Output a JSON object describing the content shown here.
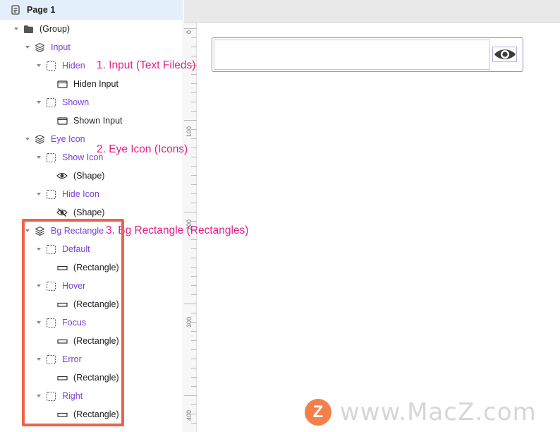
{
  "layers_panel": {
    "page": {
      "label": "Page 1",
      "icon": "page-icon"
    },
    "rows": [
      {
        "label": "(Group)",
        "icon": "folder-icon",
        "style": "dark",
        "chevron": true
      },
      {
        "label": "Input",
        "icon": "layers-icon",
        "style": "purple",
        "chevron": true
      },
      {
        "label": "Hiden",
        "icon": "dashed-frame-icon",
        "style": "purple",
        "chevron": true
      },
      {
        "label": "Hiden Input",
        "icon": "input-box-icon",
        "style": "dark",
        "chevron": false
      },
      {
        "label": "Shown",
        "icon": "dashed-frame-icon",
        "style": "purple",
        "chevron": true
      },
      {
        "label": "Shown Input",
        "icon": "input-box-icon",
        "style": "dark",
        "chevron": false
      },
      {
        "label": "Eye Icon",
        "icon": "layers-icon",
        "style": "purple",
        "chevron": true
      },
      {
        "label": "Show Icon",
        "icon": "dashed-frame-icon",
        "style": "purple",
        "chevron": true
      },
      {
        "label": "(Shape)",
        "icon": "eye-icon",
        "style": "dark",
        "chevron": false
      },
      {
        "label": "Hide Icon",
        "icon": "dashed-frame-icon",
        "style": "purple",
        "chevron": true
      },
      {
        "label": "(Shape)",
        "icon": "eye-off-icon",
        "style": "dark",
        "chevron": false
      },
      {
        "label": "Bg Rectangle",
        "icon": "layers-icon",
        "style": "purple",
        "chevron": true
      },
      {
        "label": "Default",
        "icon": "dashed-frame-icon",
        "style": "purple",
        "chevron": true
      },
      {
        "label": "(Rectangle)",
        "icon": "rectangle-icon",
        "style": "dark",
        "chevron": false
      },
      {
        "label": "Hover",
        "icon": "dashed-frame-icon",
        "style": "purple",
        "chevron": true
      },
      {
        "label": "(Rectangle)",
        "icon": "rectangle-icon",
        "style": "dark",
        "chevron": false
      },
      {
        "label": "Focus",
        "icon": "dashed-frame-icon",
        "style": "purple",
        "chevron": true
      },
      {
        "label": "(Rectangle)",
        "icon": "rectangle-icon",
        "style": "dark",
        "chevron": false
      },
      {
        "label": "Error",
        "icon": "dashed-frame-icon",
        "style": "purple",
        "chevron": true
      },
      {
        "label": "(Rectangle)",
        "icon": "rectangle-icon",
        "style": "dark",
        "chevron": false
      },
      {
        "label": "Right",
        "icon": "dashed-frame-icon",
        "style": "purple",
        "chevron": true
      },
      {
        "label": "(Rectangle)",
        "icon": "rectangle-icon",
        "style": "dark",
        "chevron": false
      }
    ]
  },
  "ruler": {
    "labels": [
      "0",
      "100",
      "200",
      "300",
      "400"
    ]
  },
  "annotations": [
    "1. Input (Text Fileds)",
    "2. Eye Icon (Icons)",
    "3. Bg Rectangle (Rectangles)"
  ],
  "watermark": {
    "logo_letter": "Z",
    "text": "www.MacZ.com"
  },
  "colors": {
    "accent_purple": "#7a3fd9",
    "annotation_pink": "#e0218a",
    "highlight_red": "#f0614a",
    "selected_row_bg": "#e3f0fb"
  }
}
